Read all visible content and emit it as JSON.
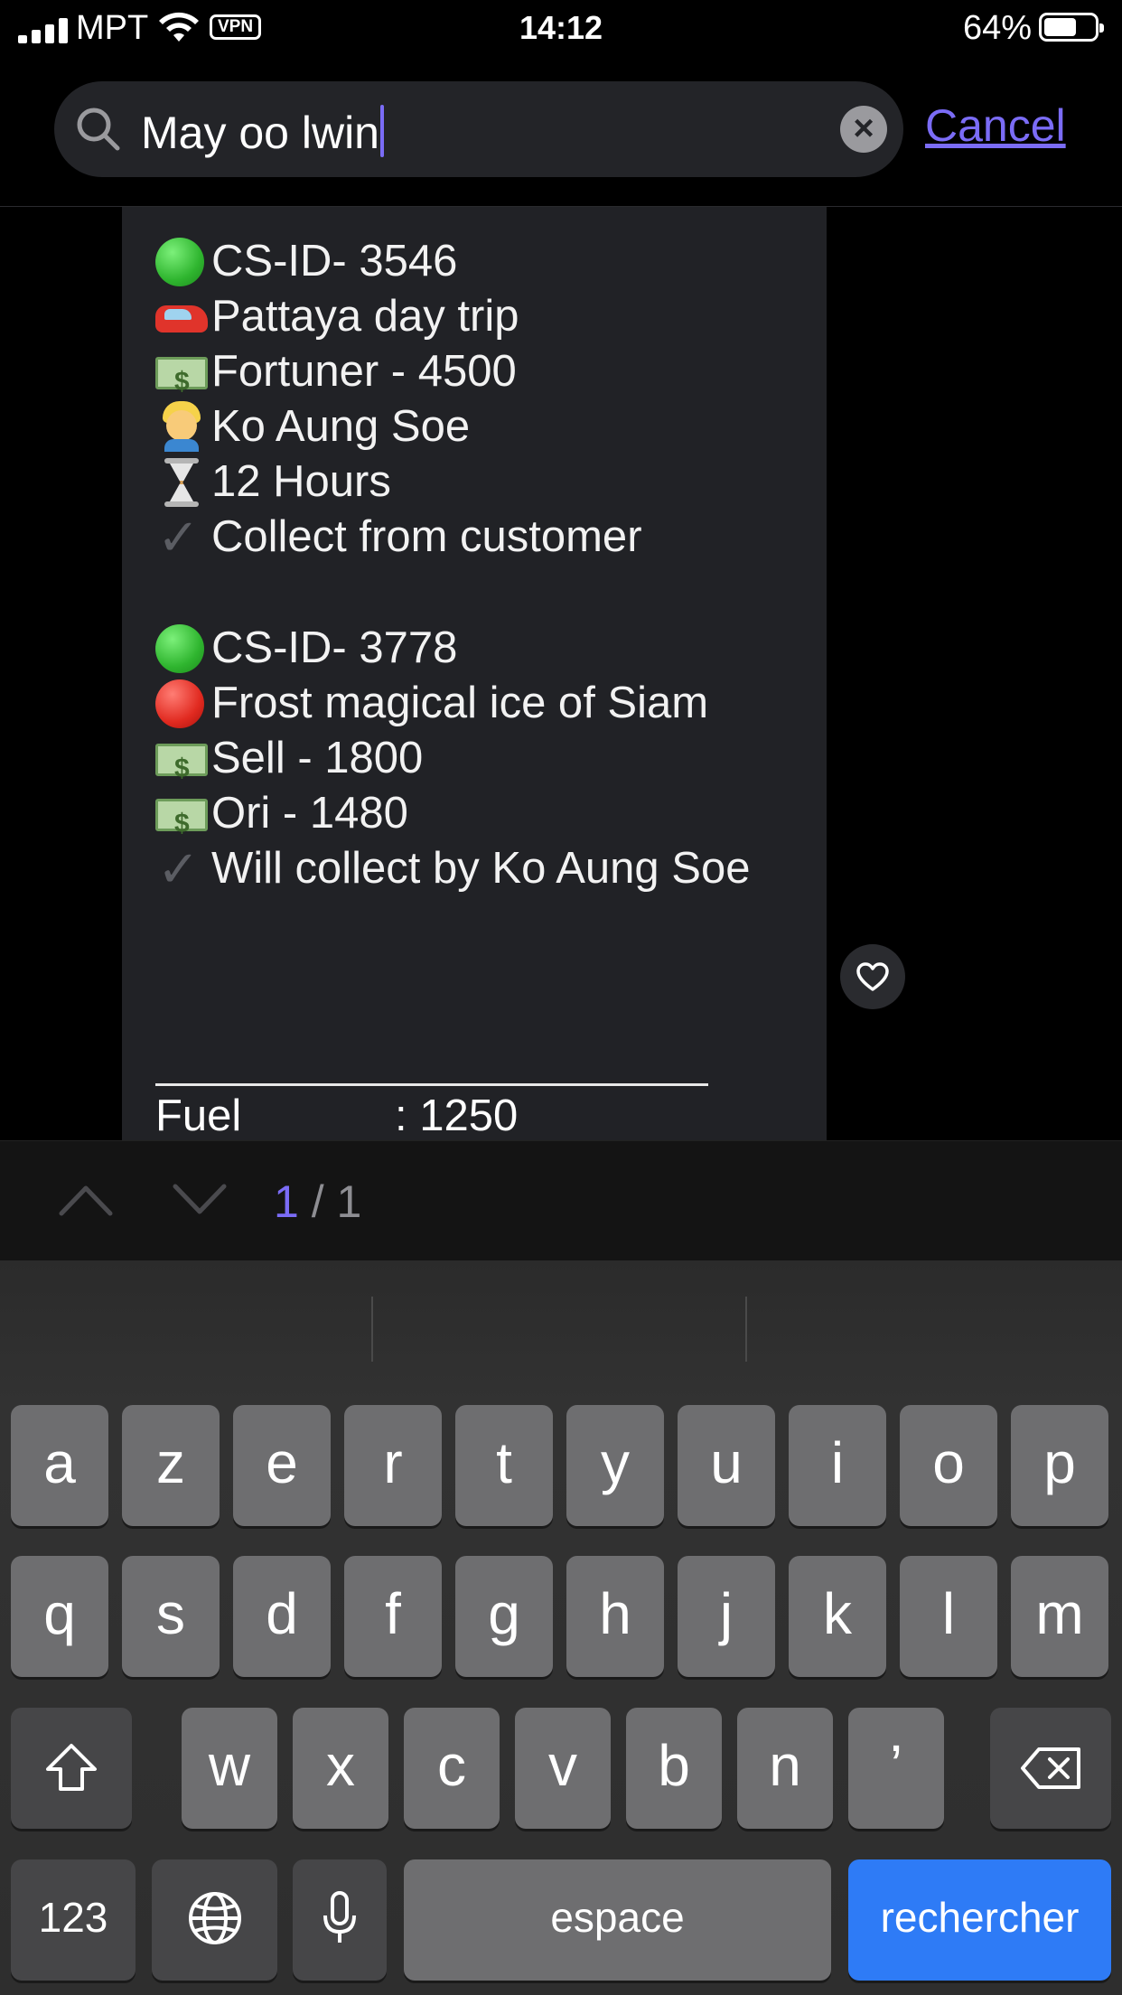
{
  "status_bar": {
    "carrier": "MPT",
    "vpn_badge": "VPN",
    "time": "14:12",
    "battery_percent": "64%",
    "battery_level": 0.64
  },
  "search": {
    "query": "May oo lwin",
    "cancel_label": "Cancel",
    "clear_icon": "clear-icon",
    "search_icon": "search-icon"
  },
  "message": {
    "blocks": [
      {
        "lines": [
          {
            "emoji": "green-circle",
            "text": "CS-ID- 3546"
          },
          {
            "emoji": "car",
            "text": "Pattaya day trip"
          },
          {
            "emoji": "money",
            "text": "Fortuner - 4500"
          },
          {
            "emoji": "person",
            "text": "Ko Aung Soe"
          },
          {
            "emoji": "hourglass",
            "text": "12 Hours"
          },
          {
            "emoji": "check",
            "text": "Collect from customer"
          }
        ]
      },
      {
        "lines": [
          {
            "emoji": "green-circle",
            "text": "CS-ID- 3778"
          },
          {
            "emoji": "red-circle",
            "text": "Frost magical ice of Siam"
          },
          {
            "emoji": "money",
            "text": "Sell - 1800"
          },
          {
            "emoji": "money",
            "text": "Ori - 1480"
          },
          {
            "emoji": "check",
            "text": "Will collect by Ko Aung Soe"
          }
        ]
      }
    ],
    "fuel_label": "Fuel",
    "fuel_value": ": 1250"
  },
  "result_nav": {
    "current": "1",
    "separator": " / ",
    "total": "1"
  },
  "keyboard": {
    "row1": [
      "a",
      "z",
      "e",
      "r",
      "t",
      "y",
      "u",
      "i",
      "o",
      "p"
    ],
    "row2": [
      "q",
      "s",
      "d",
      "f",
      "g",
      "h",
      "j",
      "k",
      "l",
      "m"
    ],
    "row3": [
      "w",
      "x",
      "c",
      "v",
      "b",
      "n",
      "’"
    ],
    "numbers_label": "123",
    "space_label": "espace",
    "action_label": "rechercher"
  },
  "colors": {
    "accent": "#7b6cf6",
    "bubble": "#212226",
    "action_key": "#2e7bf6"
  }
}
